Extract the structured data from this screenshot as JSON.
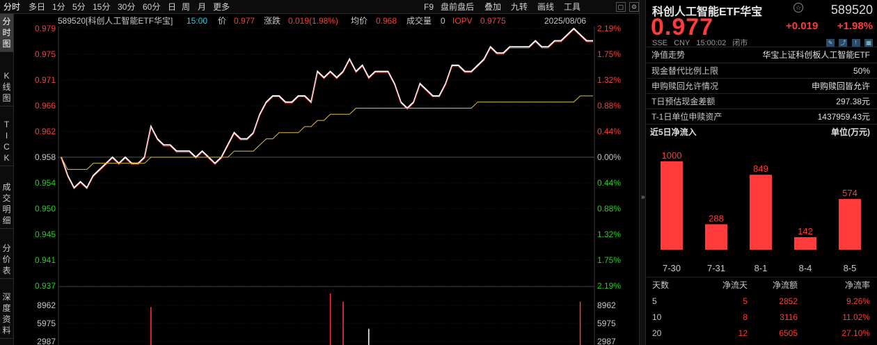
{
  "toolbar": {
    "left_items": [
      "分时",
      "多日",
      "1分",
      "5分",
      "15分",
      "30分",
      "60分",
      "日",
      "周",
      "月",
      "更多"
    ],
    "right_items": [
      "F9",
      "盘前盘后",
      "叠加",
      "九转",
      "画线",
      "工具"
    ],
    "icons": [
      "window-icon",
      "settings-icon"
    ]
  },
  "vtabs": [
    {
      "label": "分时图",
      "active": true
    },
    {
      "label": "K线图",
      "active": false
    },
    {
      "label": "TICK",
      "active": false
    },
    {
      "label": "成交明细",
      "active": false
    },
    {
      "label": "分价表",
      "active": false
    },
    {
      "label": "深度资料",
      "active": false
    }
  ],
  "info_bar": {
    "code_name": "589520[科创人工智能ETF华宝]",
    "time": "15:00",
    "price_label": "价",
    "price": "0.977",
    "change_label": "涨跌",
    "change": "0.019(1.98%)",
    "avg_label": "均价",
    "avg": "0.968",
    "volume_label": "成交量",
    "volume": "0",
    "iopv_label": "IOPV",
    "iopv": "0.9775",
    "date": "2025/08/06"
  },
  "chart_data": {
    "type": "line",
    "price_axis_left": [
      "0.979",
      "0.975",
      "0.971",
      "0.966",
      "0.962",
      "0.958",
      "0.954",
      "0.950",
      "0.945",
      "0.941",
      "0.937"
    ],
    "price_axis_right": [
      "2.19%",
      "1.75%",
      "1.32%",
      "0.88%",
      "0.44%",
      "0.00%",
      "0.44%",
      "0.88%",
      "1.32%",
      "1.75%",
      "2.19%"
    ],
    "volume_axis_left": [
      "8962",
      "5975",
      "2987"
    ],
    "volume_axis_right": [
      "8962",
      "5975",
      "2987"
    ],
    "ylim": [
      0.937,
      0.979
    ],
    "prev_close": 0.958,
    "series": [
      {
        "color": "#ffffff",
        "values": [
          0.958,
          0.955,
          0.953,
          0.954,
          0.953,
          0.955,
          0.956,
          0.957,
          0.958,
          0.957,
          0.958,
          0.957,
          0.957,
          0.958,
          0.963,
          0.961,
          0.96,
          0.96,
          0.959,
          0.959,
          0.959,
          0.958,
          0.959,
          0.958,
          0.957,
          0.958,
          0.96,
          0.962,
          0.961,
          0.961,
          0.962,
          0.965,
          0.967,
          0.968,
          0.968,
          0.967,
          0.967,
          0.968,
          0.968,
          0.967,
          0.972,
          0.971,
          0.972,
          0.971,
          0.972,
          0.974,
          0.972,
          0.973,
          0.971,
          0.972,
          0.972,
          0.972,
          0.97,
          0.967,
          0.966,
          0.967,
          0.97,
          0.969,
          0.968,
          0.968,
          0.97,
          0.973,
          0.973,
          0.972,
          0.972,
          0.973,
          0.974,
          0.976,
          0.975,
          0.975,
          0.976,
          0.976,
          0.976,
          0.976,
          0.977,
          0.976,
          0.976,
          0.977,
          0.977,
          0.978,
          0.979,
          0.978,
          0.977,
          0.977
        ]
      },
      {
        "color": "#e0c040",
        "values": [
          0.958,
          0.956,
          0.956,
          0.956,
          0.956,
          0.957,
          0.957,
          0.957,
          0.957,
          0.957,
          0.957,
          0.957,
          0.957,
          0.957,
          0.958,
          0.958,
          0.958,
          0.958,
          0.958,
          0.958,
          0.958,
          0.958,
          0.958,
          0.958,
          0.958,
          0.958,
          0.958,
          0.959,
          0.959,
          0.959,
          0.959,
          0.96,
          0.961,
          0.961,
          0.962,
          0.962,
          0.962,
          0.962,
          0.963,
          0.963,
          0.964,
          0.964,
          0.965,
          0.965,
          0.965,
          0.965,
          0.966,
          0.966,
          0.966,
          0.966,
          0.966,
          0.966,
          0.966,
          0.966,
          0.966,
          0.966,
          0.966,
          0.966,
          0.966,
          0.966,
          0.966,
          0.966,
          0.966,
          0.966,
          0.966,
          0.967,
          0.967,
          0.967,
          0.967,
          0.967,
          0.967,
          0.967,
          0.967,
          0.967,
          0.967,
          0.967,
          0.967,
          0.967,
          0.967,
          0.967,
          0.967,
          0.968,
          0.968,
          0.968
        ]
      }
    ],
    "volume": [
      0,
      0,
      0,
      0,
      0,
      0,
      0,
      0,
      0,
      0,
      0,
      0,
      0,
      0,
      0.7,
      0,
      0,
      0,
      0,
      0,
      0,
      0,
      0,
      0,
      0,
      0,
      0,
      0,
      0,
      0,
      0,
      0,
      0,
      0,
      0,
      0,
      0,
      0,
      0,
      0,
      0,
      0,
      0.95,
      0,
      0.8,
      0,
      0,
      0,
      0.3,
      0,
      0,
      0,
      0,
      0,
      0,
      0,
      0,
      0,
      0,
      0,
      0,
      0,
      0,
      0,
      0,
      0,
      0,
      0,
      0,
      0,
      0,
      0,
      0,
      0,
      0,
      0,
      0,
      0,
      0,
      0,
      0,
      0.8,
      0,
      0
    ]
  },
  "right_panel": {
    "title": "科创人工智能ETF华宝",
    "code": "589520",
    "price": "0.977",
    "change": "+0.019",
    "change_pct": "+1.98%",
    "meta": [
      "SSE",
      "CNY",
      "15:00:02",
      "闭市"
    ],
    "net_value_label": "净值走势",
    "net_value_value": "华宝上证科创板人工智能ETF",
    "rows": [
      {
        "k": "现金替代比例上限",
        "v": "50%"
      },
      {
        "k": "申购赎回允许情况",
        "v": "申购赎回皆允许"
      },
      {
        "k": "T日预估现金差额",
        "v": "297.38元"
      },
      {
        "k": "T-1日单位申赎资产",
        "v": "1437959.43元"
      }
    ],
    "flow_title": "近5日净流入",
    "flow_unit": "单位(万元)",
    "flow_chart": {
      "type": "bar",
      "categories": [
        "7-30",
        "7-31",
        "8-1",
        "8-4",
        "8-5"
      ],
      "values": [
        1000,
        288,
        849,
        142,
        574
      ],
      "color": "#ff3b3b"
    },
    "table": {
      "headers": [
        "天数",
        "净流天",
        "净流额",
        "净流率"
      ],
      "rows": [
        [
          "5",
          "5",
          "2852",
          "9.26%"
        ],
        [
          "10",
          "8",
          "3116",
          "11.02%"
        ],
        [
          "20",
          "12",
          "6505",
          "27.10%"
        ]
      ]
    }
  }
}
